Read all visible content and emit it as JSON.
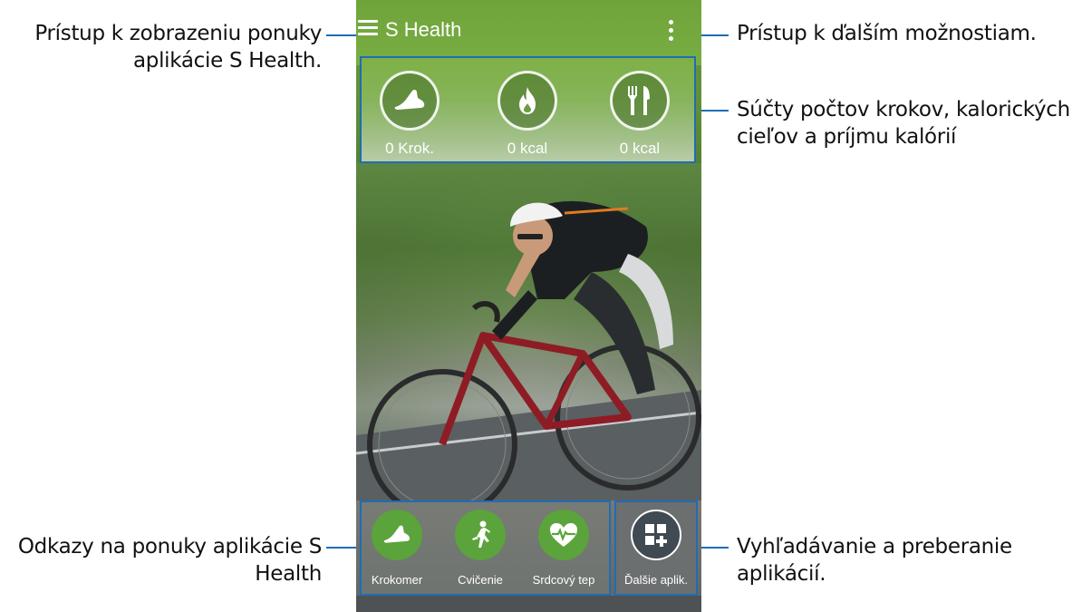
{
  "app": {
    "title": "S Health"
  },
  "stats": [
    {
      "icon": "shoe-icon",
      "value": "0 Krok."
    },
    {
      "icon": "flame-icon",
      "value": "0 kcal"
    },
    {
      "icon": "fork-knife-icon",
      "value": "0 kcal"
    }
  ],
  "shortcuts": [
    {
      "icon": "shoe-icon",
      "label": "Krokomer"
    },
    {
      "icon": "runner-icon",
      "label": "Cvičenie"
    },
    {
      "icon": "heart-rate-icon",
      "label": "Srdcový tep"
    }
  ],
  "more": {
    "icon": "add-apps-icon",
    "label": "Ďalšie aplik."
  },
  "callouts": {
    "menu": "Prístup k zobrazeniu ponuky aplikácie S Health.",
    "more_options": "Prístup k ďalším možnostiam.",
    "totals": "Súčty počtov krokov, kalorických cieľov a príjmu kalórií",
    "shortcuts": "Odkazy na ponuky aplikácie S Health",
    "search": "Vyhľadávanie a preberanie aplikácií."
  },
  "colors": {
    "accent": "#1f6db4",
    "green": "#5ba33b"
  }
}
